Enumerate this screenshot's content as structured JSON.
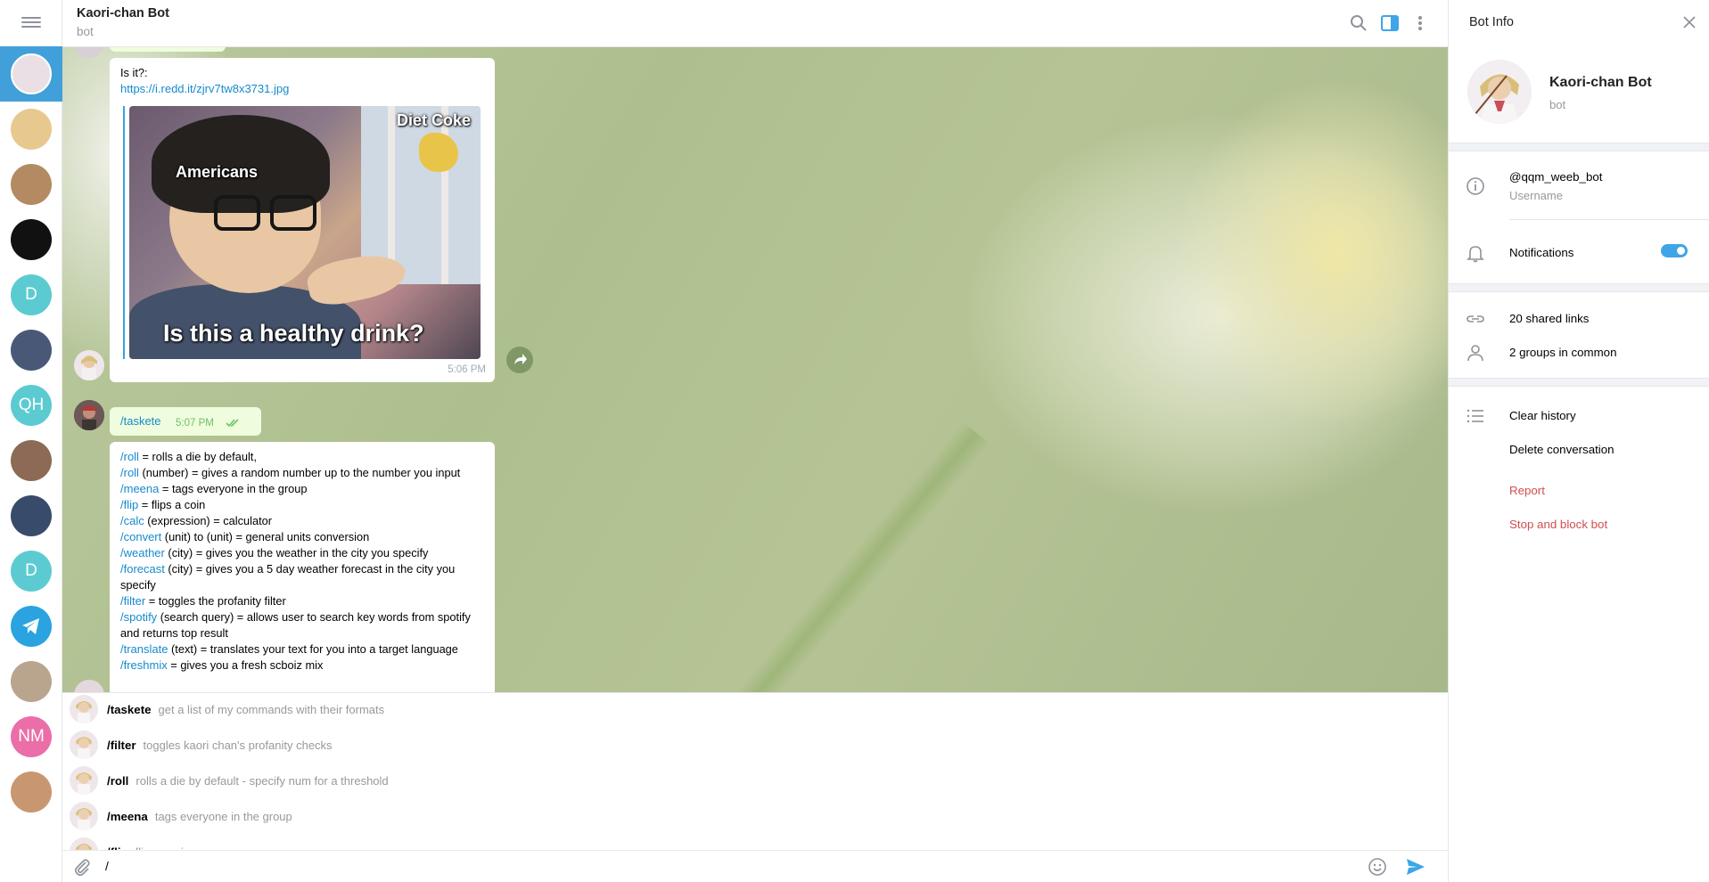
{
  "header": {
    "title": "Kaori-chan Bot",
    "subtitle": "bot"
  },
  "chats": [
    {
      "id": "kaori",
      "initials": "",
      "color": "#e9dfe5",
      "active": true
    },
    {
      "id": "potato",
      "initials": "",
      "color": "#e7c98f"
    },
    {
      "id": "dog",
      "initials": "",
      "color": "#b48a62"
    },
    {
      "id": "koala",
      "initials": "",
      "color": "#111111"
    },
    {
      "id": "d1",
      "initials": "D",
      "color": "#5ccbd1"
    },
    {
      "id": "man",
      "initials": "",
      "color": "#4a5878"
    },
    {
      "id": "qh",
      "initials": "QH",
      "color": "#5ccbd1"
    },
    {
      "id": "canyon",
      "initials": "",
      "color": "#8d6a55"
    },
    {
      "id": "boy",
      "initials": "",
      "color": "#394b6a"
    },
    {
      "id": "d2",
      "initials": "D",
      "color": "#5ccbd1"
    },
    {
      "id": "telegram",
      "initials": "",
      "color": "#2aa3e0"
    },
    {
      "id": "room",
      "initials": "",
      "color": "#b9a58e"
    },
    {
      "id": "nm",
      "initials": "NM",
      "color": "#eb6ea9"
    },
    {
      "id": "smile",
      "initials": "",
      "color": "#c89670"
    }
  ],
  "messages": {
    "meme_msg": {
      "text": "Is it?:",
      "link": "https://i.redd.it/zjrv7tw8x3731.jpg",
      "meme_caption_top": "Diet Coke",
      "meme_caption_left": "Americans",
      "meme_caption_bottom": "Is this a healthy drink?",
      "time": "5:06 PM"
    },
    "outgoing": {
      "text": "/taskete",
      "time": "5:07 PM"
    },
    "commands": [
      {
        "cmd": "/roll",
        "desc": " = rolls a die by default,"
      },
      {
        "cmd": "/roll",
        "desc": " (number) = gives a random number up to the number you input"
      },
      {
        "cmd": "/meena",
        "desc": " = tags everyone in the group"
      },
      {
        "cmd": "/flip",
        "desc": " = flips a coin"
      },
      {
        "cmd": "/calc",
        "desc": " (expression) = calculator"
      },
      {
        "cmd": "/convert",
        "desc": " (unit) to (unit) = general units conversion"
      },
      {
        "cmd": "/weather",
        "desc": " (city) = gives you the weather in the city you specify"
      },
      {
        "cmd": "/forecast",
        "desc": " (city) = gives you a 5 day weather forecast in the city you specify"
      },
      {
        "cmd": "/filter",
        "desc": " = toggles the profanity filter"
      },
      {
        "cmd": "/spotify",
        "desc": " (search query) = allows user to search key words from spotify and returns top result"
      },
      {
        "cmd": "/translate",
        "desc": " (text) = translates your text for you into a target language"
      },
      {
        "cmd": "/freshmix",
        "desc": " = gives you a fresh scboiz mix"
      }
    ]
  },
  "suggestions": [
    {
      "cmd": "/taskete",
      "desc": "get a list of my commands with their formats"
    },
    {
      "cmd": "/filter",
      "desc": "toggles kaori chan's profanity checks"
    },
    {
      "cmd": "/roll",
      "desc": "rolls a die by default - specify num for a threshold"
    },
    {
      "cmd": "/meena",
      "desc": "tags everyone in the group"
    },
    {
      "cmd": "/flip",
      "desc": "flips a coin"
    }
  ],
  "input": {
    "value": "/"
  },
  "bot_info": {
    "title": "Bot Info",
    "name": "Kaori-chan Bot",
    "subtitle": "bot",
    "username": "@qqm_weeb_bot",
    "username_label": "Username",
    "notifications_label": "Notifications",
    "notifications_on": true,
    "shared_links": "20 shared links",
    "groups_common": "2 groups in common",
    "clear_history": "Clear history",
    "delete_conversation": "Delete conversation",
    "report": "Report",
    "stop_block": "Stop and block bot"
  },
  "colors": {
    "accent": "#419fd9",
    "link": "#168acd",
    "danger": "#d14e4e",
    "bubble_out": "#effdde"
  }
}
